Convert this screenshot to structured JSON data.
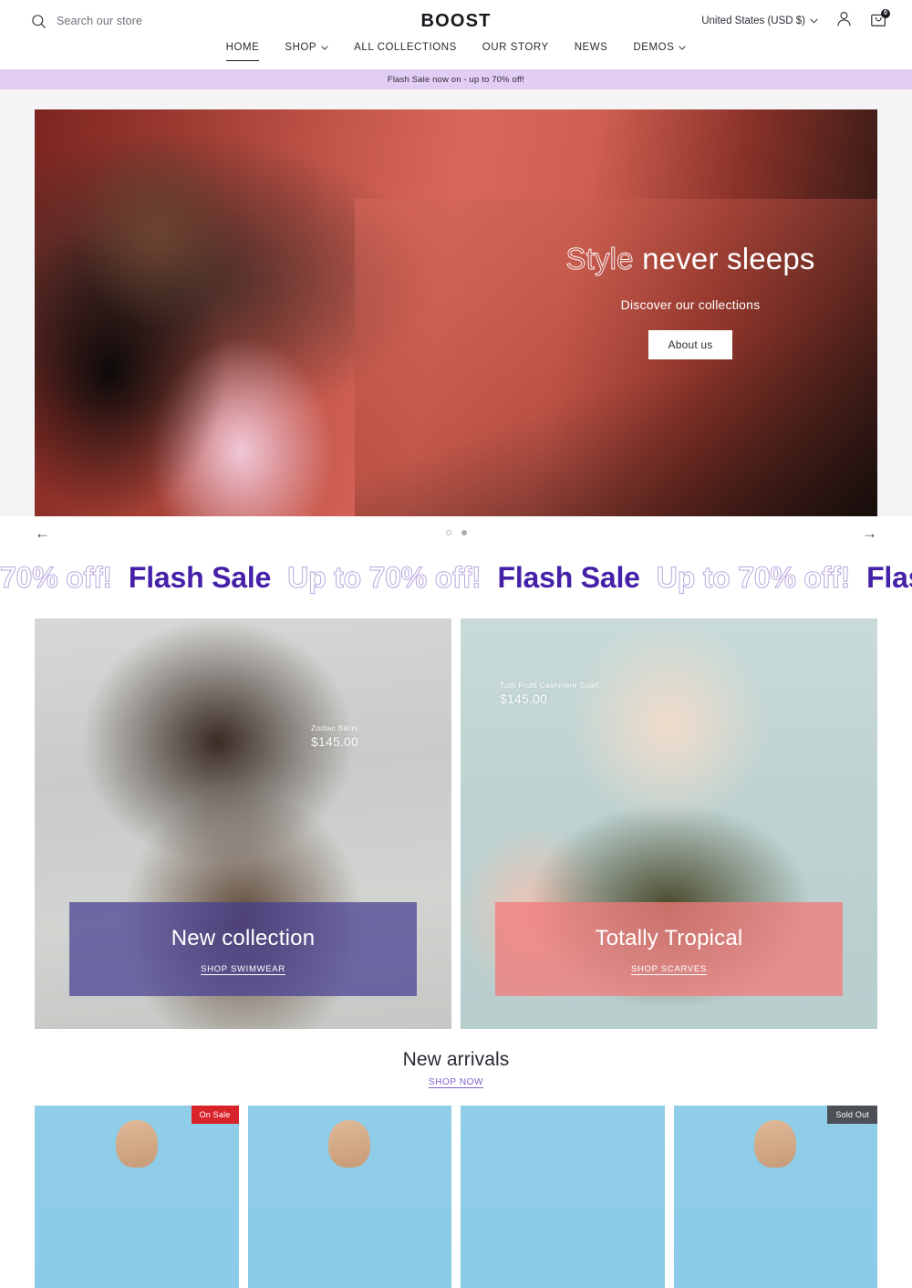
{
  "header": {
    "search": {
      "icon": "search-icon",
      "placeholder": "Search our store"
    },
    "logo": "BOOST",
    "locale": {
      "label": "United States (USD $)",
      "chevron": "chevron-down-icon"
    },
    "account_icon": "user-icon",
    "cart_icon": "cart-icon",
    "cart_count": "0"
  },
  "nav": {
    "items": [
      {
        "label": "HOME",
        "active": true,
        "has_chevron": false
      },
      {
        "label": "SHOP",
        "active": false,
        "has_chevron": true
      },
      {
        "label": "ALL COLLECTIONS",
        "active": false,
        "has_chevron": false
      },
      {
        "label": "OUR STORY",
        "active": false,
        "has_chevron": false
      },
      {
        "label": "NEWS",
        "active": false,
        "has_chevron": false
      },
      {
        "label": "DEMOS",
        "active": false,
        "has_chevron": true
      }
    ]
  },
  "announcement": {
    "text": "Flash Sale now on - up to 70% off!",
    "bg": "#e2cdf4"
  },
  "hero": {
    "title_outline": "Style",
    "title_rest": " never sleeps",
    "subtitle": "Discover our collections",
    "button": "About us",
    "prev_arrow": "←",
    "next_arrow": "→",
    "slides": [
      {
        "active": false
      },
      {
        "active": true
      }
    ]
  },
  "marquee": {
    "solid_text": "Flash Sale",
    "outline_text": "Up to 70% off!",
    "solid_color": "#4520a8",
    "outline_color": "#b9a8de",
    "segments": [
      {
        "type": "outline",
        "text": "70% off!"
      },
      {
        "type": "solid",
        "text": "Flash Sale"
      },
      {
        "type": "outline",
        "text": "Up to 70% off!"
      },
      {
        "type": "solid",
        "text": "Flash Sale"
      },
      {
        "type": "outline",
        "text": "Up to 70% off!"
      },
      {
        "type": "solid",
        "text": "Flash Sal"
      }
    ]
  },
  "collections": [
    {
      "product_name": "Zodiac Bikini",
      "product_price": "$145.00",
      "title": "New collection",
      "link": "SHOP SWIMWEAR",
      "overlay_color": "#463e92"
    },
    {
      "product_name": "Tutti Frutti Cashmere Scarf",
      "product_price": "$145.00",
      "title": "Totally Tropical",
      "link": "SHOP SCARVES",
      "overlay_color": "#f07c7c"
    }
  ],
  "arrivals": {
    "title": "New arrivals",
    "link": "SHOP NOW",
    "link_color": "#7c5fc9",
    "products": [
      {
        "badge": "On Sale",
        "badge_type": "sale"
      },
      {
        "badge": "",
        "badge_type": "none"
      },
      {
        "badge": "",
        "badge_type": "none"
      },
      {
        "badge": "Sold Out",
        "badge_type": "sold"
      }
    ]
  }
}
